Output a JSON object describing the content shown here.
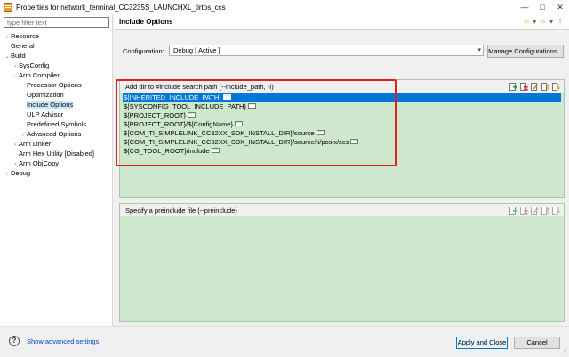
{
  "window": {
    "title": "Properties for network_terminal_CC3235S_LAUNCHXL_tirtos_ccs",
    "minimize": "—",
    "maximize": "□",
    "close": "✕"
  },
  "filter": {
    "placeholder": "type filter text"
  },
  "tree": [
    {
      "label": "Resource",
      "toggle": "›",
      "level": 0
    },
    {
      "label": "General",
      "toggle": "",
      "level": 0
    },
    {
      "label": "Build",
      "toggle": "⌄",
      "level": 0
    },
    {
      "label": "SysConfig",
      "toggle": "›",
      "level": 1
    },
    {
      "label": "Arm Compiler",
      "toggle": "⌄",
      "level": 1
    },
    {
      "label": "Processor Options",
      "toggle": "",
      "level": 2
    },
    {
      "label": "Optimization",
      "toggle": "",
      "level": 2
    },
    {
      "label": "Include Options",
      "toggle": "",
      "level": 2,
      "selected": true
    },
    {
      "label": "ULP Advisor",
      "toggle": "",
      "level": 2
    },
    {
      "label": "Predefined Symbols",
      "toggle": "",
      "level": 2
    },
    {
      "label": "Advanced Options",
      "toggle": "›",
      "level": 2
    },
    {
      "label": "Arm Linker",
      "toggle": "›",
      "level": 1
    },
    {
      "label": "Arm Hex Utility  [Disabled]",
      "toggle": "",
      "level": 1
    },
    {
      "label": "Arm ObjCopy",
      "toggle": "›",
      "level": 1
    },
    {
      "label": "Debug",
      "toggle": "›",
      "level": 0
    }
  ],
  "page": {
    "title": "Include Options",
    "nav_back": "⇦",
    "nav_back_menu": "▾",
    "nav_fwd": "⇨",
    "nav_fwd_menu": "▾",
    "nav_menu": "⋮"
  },
  "configuration": {
    "label": "Configuration:",
    "value": "Debug  [ Active ]",
    "manage_label": "Manage Configurations..."
  },
  "include_path": {
    "label": "Add dir to #include search path (--include_path, -I)",
    "items": [
      "${INHERITED_INCLUDE_PATH}",
      "${SYSCONFIG_TOOL_INCLUDE_PATH}",
      "${PROJECT_ROOT}",
      "${PROJECT_ROOT}/${ConfigName}",
      "${COM_TI_SIMPLELINK_CC32XX_SDK_INSTALL_DIR}/source",
      "${COM_TI_SIMPLELINK_CC32XX_SDK_INSTALL_DIR}/source/ti/posix/ccs",
      "${CG_TOOL_ROOT}/include"
    ],
    "selected_index": 0
  },
  "preinclude": {
    "label": "Specify a preinclude file (--preinclude)"
  },
  "tool_icons": [
    "add-icon",
    "delete-icon",
    "edit-icon",
    "move-up-icon",
    "move-down-icon"
  ],
  "footer": {
    "help": "?",
    "advanced_link": "Show advanced settings",
    "apply_label": "Apply and Close",
    "cancel_label": "Cancel"
  },
  "colors": {
    "selection": "#0078d7",
    "panel_bg": "#cde8cd",
    "highlight_box": "#e02020",
    "link": "#0044cc"
  }
}
